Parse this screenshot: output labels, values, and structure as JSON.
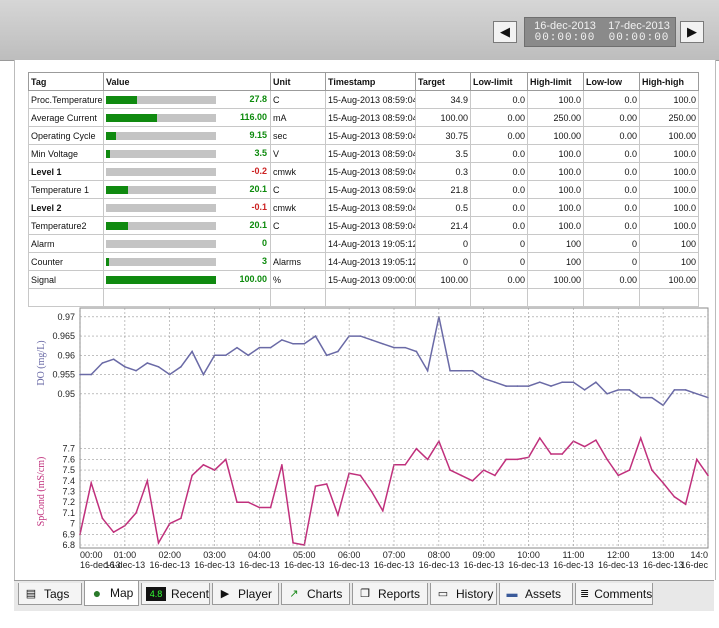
{
  "header": {
    "prev_label": "◀",
    "next_label": "▶",
    "start_date": "16-dec-2013",
    "start_time": "00:00:00",
    "end_date": "17-dec-2013",
    "end_time": "00:00:00"
  },
  "table": {
    "headers": [
      "Tag",
      "Value",
      "Unit",
      "Timestamp",
      "Target",
      "Low-limit",
      "High-limit",
      "Low-low",
      "High-high"
    ],
    "rows": [
      {
        "tag": "Proc.Temperature",
        "alarm": false,
        "value": "27.8",
        "fill": 0.28,
        "unit": "C",
        "timestamp": "15-Aug-2013 08:59:04",
        "target": "34.9",
        "low_limit": "0.0",
        "high_limit": "100.0",
        "low_low": "0.0",
        "high_high": "100.0"
      },
      {
        "tag": "Average Current",
        "alarm": false,
        "value": "116.00",
        "fill": 0.46,
        "unit": "mA",
        "timestamp": "15-Aug-2013 08:59:04",
        "target": "100.00",
        "low_limit": "0.00",
        "high_limit": "250.00",
        "low_low": "0.00",
        "high_high": "250.00"
      },
      {
        "tag": "Operating Cycle",
        "alarm": false,
        "value": "9.15",
        "fill": 0.09,
        "unit": "sec",
        "timestamp": "15-Aug-2013 08:59:04",
        "target": "30.75",
        "low_limit": "0.00",
        "high_limit": "100.00",
        "low_low": "0.00",
        "high_high": "100.00"
      },
      {
        "tag": "Min Voltage",
        "alarm": false,
        "value": "3.5",
        "fill": 0.035,
        "unit": "V",
        "timestamp": "15-Aug-2013 08:59:04",
        "target": "3.5",
        "low_limit": "0.0",
        "high_limit": "100.0",
        "low_low": "0.0",
        "high_high": "100.0"
      },
      {
        "tag": "Level 1",
        "alarm": true,
        "value": "-0.2",
        "fill": 0,
        "unit": "cmwk",
        "timestamp": "15-Aug-2013 08:59:04",
        "target": "0.3",
        "low_limit": "0.0",
        "high_limit": "100.0",
        "low_low": "0.0",
        "high_high": "100.0"
      },
      {
        "tag": "Temperature 1",
        "alarm": false,
        "value": "20.1",
        "fill": 0.2,
        "unit": "C",
        "timestamp": "15-Aug-2013 08:59:04",
        "target": "21.8",
        "low_limit": "0.0",
        "high_limit": "100.0",
        "low_low": "0.0",
        "high_high": "100.0"
      },
      {
        "tag": "Level 2",
        "alarm": true,
        "value": "-0.1",
        "fill": 0,
        "unit": "cmwk",
        "timestamp": "15-Aug-2013 08:59:04",
        "target": "0.5",
        "low_limit": "0.0",
        "high_limit": "100.0",
        "low_low": "0.0",
        "high_high": "100.0"
      },
      {
        "tag": "Temperature2",
        "alarm": false,
        "value": "20.1",
        "fill": 0.2,
        "unit": "C",
        "timestamp": "15-Aug-2013 08:59:04",
        "target": "21.4",
        "low_limit": "0.0",
        "high_limit": "100.0",
        "low_low": "0.0",
        "high_high": "100.0"
      },
      {
        "tag": "Alarm",
        "alarm": false,
        "value": "0",
        "fill": 0,
        "unit": "",
        "timestamp": "14-Aug-2013 19:05:12",
        "target": "0",
        "low_limit": "0",
        "high_limit": "100",
        "low_low": "0",
        "high_high": "100"
      },
      {
        "tag": "Counter",
        "alarm": false,
        "value": "3",
        "fill": 0.03,
        "unit": "Alarms",
        "timestamp": "14-Aug-2013 19:05:12",
        "target": "0",
        "low_limit": "0",
        "high_limit": "100",
        "low_low": "0",
        "high_high": "100"
      },
      {
        "tag": "Signal",
        "alarm": false,
        "value": "100.00",
        "fill": 1.0,
        "unit": "%",
        "timestamp": "15-Aug-2013 09:00:00",
        "target": "100.00",
        "low_limit": "0.00",
        "high_limit": "100.00",
        "low_low": "0.00",
        "high_high": "100.00"
      }
    ]
  },
  "chart_data": [
    {
      "type": "line",
      "ylabel": "DO (mg/L)",
      "ylim": [
        0.945,
        0.971
      ],
      "yticks": [
        "0.97",
        "0.965",
        "0.96",
        "0.955",
        "0.95"
      ],
      "color": "#6a6aa6",
      "grid": true,
      "x": [
        0,
        0.25,
        0.5,
        0.75,
        1.0,
        1.25,
        1.5,
        1.75,
        2.0,
        2.25,
        2.5,
        2.75,
        3.0,
        3.25,
        3.5,
        3.75,
        4.0,
        4.25,
        4.5,
        4.75,
        5.0,
        5.25,
        5.5,
        5.75,
        6.0,
        6.25,
        6.5,
        6.75,
        7.0,
        7.25,
        7.5,
        7.75,
        8.0,
        8.25,
        8.5,
        8.75,
        9.0,
        9.25,
        9.5,
        9.75,
        10.0,
        10.25,
        10.5,
        10.75,
        11.0,
        11.25,
        11.5,
        11.75,
        12.0,
        12.25,
        12.5,
        12.75,
        13.0,
        13.25,
        13.5,
        13.75,
        14.0
      ],
      "values": [
        0.955,
        0.955,
        0.958,
        0.959,
        0.957,
        0.956,
        0.958,
        0.957,
        0.955,
        0.957,
        0.961,
        0.955,
        0.96,
        0.96,
        0.962,
        0.96,
        0.962,
        0.962,
        0.964,
        0.963,
        0.963,
        0.965,
        0.96,
        0.961,
        0.965,
        0.965,
        0.964,
        0.963,
        0.962,
        0.962,
        0.961,
        0.956,
        0.97,
        0.956,
        0.956,
        0.956,
        0.954,
        0.953,
        0.952,
        0.952,
        0.952,
        0.953,
        0.952,
        0.953,
        0.953,
        0.951,
        0.953,
        0.95,
        0.951,
        0.951,
        0.949,
        0.949,
        0.947,
        0.951,
        0.951,
        0.95,
        0.949
      ]
    },
    {
      "type": "line",
      "ylabel": "SpCond (mS/cm)",
      "ylim": [
        6.8,
        7.8
      ],
      "yticks": [
        "7.7",
        "7.6",
        "7.5",
        "7.4",
        "7.3",
        "7.2",
        "7.1",
        "7",
        "6.9",
        "6.8"
      ],
      "xticks": [
        {
          "time": "00:00",
          "date": "16-dec-13"
        },
        {
          "time": "01:00",
          "date": "16-dec-13"
        },
        {
          "time": "02:00",
          "date": "16-dec-13"
        },
        {
          "time": "03:00",
          "date": "16-dec-13"
        },
        {
          "time": "04:00",
          "date": "16-dec-13"
        },
        {
          "time": "05:00",
          "date": "16-dec-13"
        },
        {
          "time": "06:00",
          "date": "16-dec-13"
        },
        {
          "time": "07:00",
          "date": "16-dec-13"
        },
        {
          "time": "08:00",
          "date": "16-dec-13"
        },
        {
          "time": "09:00",
          "date": "16-dec-13"
        },
        {
          "time": "10:00",
          "date": "16-dec-13"
        },
        {
          "time": "11:00",
          "date": "16-dec-13"
        },
        {
          "time": "12:00",
          "date": "16-dec-13"
        },
        {
          "time": "13:00",
          "date": "16-dec-13"
        },
        {
          "time": "14:0",
          "date": "16-dec"
        }
      ],
      "color": "#c0307c",
      "grid": true,
      "x": [
        0,
        0.25,
        0.5,
        0.75,
        1.0,
        1.25,
        1.5,
        1.75,
        2.0,
        2.25,
        2.5,
        2.75,
        3.0,
        3.25,
        3.5,
        3.75,
        4.0,
        4.25,
        4.5,
        4.75,
        5.0,
        5.25,
        5.5,
        5.75,
        6.0,
        6.25,
        6.5,
        6.75,
        7.0,
        7.25,
        7.5,
        7.75,
        8.0,
        8.25,
        8.5,
        8.75,
        9.0,
        9.25,
        9.5,
        9.75,
        10.0,
        10.25,
        10.5,
        10.75,
        11.0,
        11.25,
        11.5,
        11.75,
        12.0,
        12.25,
        12.5,
        12.75,
        13.0,
        13.25,
        13.5,
        13.75,
        14.0
      ],
      "values": [
        6.9,
        7.38,
        7.05,
        6.92,
        6.98,
        7.1,
        7.4,
        6.82,
        7.0,
        7.05,
        7.45,
        7.55,
        7.5,
        7.6,
        7.2,
        7.2,
        7.15,
        7.15,
        7.55,
        6.82,
        6.8,
        7.35,
        7.37,
        7.08,
        7.47,
        7.45,
        7.3,
        7.12,
        7.55,
        7.55,
        7.7,
        7.6,
        7.77,
        7.5,
        7.45,
        7.4,
        7.5,
        7.45,
        7.6,
        7.6,
        7.62,
        7.8,
        7.65,
        7.65,
        7.77,
        7.72,
        7.78,
        7.6,
        7.45,
        7.5,
        7.8,
        7.5,
        7.38,
        7.25,
        7.18,
        7.6,
        7.45
      ]
    }
  ],
  "tabs": [
    {
      "label": "Tags",
      "icon": "tags-icon",
      "glyph": "▤"
    },
    {
      "label": "Map",
      "icon": "globe-icon",
      "glyph": "●"
    },
    {
      "label": "Recent",
      "icon": "digital-display-icon",
      "glyph": "4.8"
    },
    {
      "label": "Player",
      "icon": "play-icon",
      "glyph": "▶"
    },
    {
      "label": "Charts",
      "icon": "line-chart-icon",
      "glyph": "↗"
    },
    {
      "label": "Reports",
      "icon": "reports-icon",
      "glyph": "❐"
    },
    {
      "label": "History",
      "icon": "history-icon",
      "glyph": "▭"
    },
    {
      "label": "Assets",
      "icon": "assets-icon",
      "glyph": "▬"
    },
    {
      "label": "Comments",
      "icon": "comments-icon",
      "glyph": "≣"
    }
  ],
  "colors": {
    "bar_fill": "#108a10",
    "bar_bg": "#c4c4c4",
    "value_text": "#0c8a0c",
    "alarm_text": "#cc2222",
    "do_line": "#6a6aa6",
    "spcond_line": "#c0307c"
  }
}
